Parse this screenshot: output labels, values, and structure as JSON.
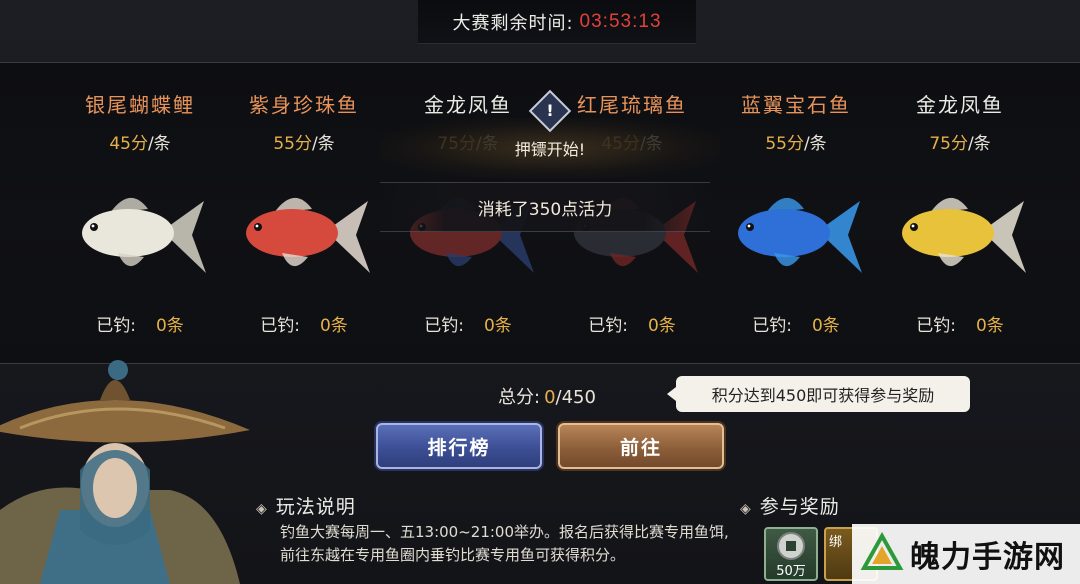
{
  "header": {
    "timer_label": "大赛剩余时间:",
    "timer_value": "03:53:13"
  },
  "fish": [
    {
      "name": "银尾蝴蝶鲤",
      "name_color": "#e8935a",
      "points": "45分",
      "unit": "/条",
      "caught_label": "已钓:",
      "caught": "0条",
      "body": "#e9e6dc",
      "fin": "#d6d2c6"
    },
    {
      "name": "紫身珍珠鱼",
      "name_color": "#e8935a",
      "points": "55分",
      "unit": "/条",
      "caught_label": "已钓:",
      "caught": "0条",
      "body": "#d64a3e",
      "fin": "#e8ddd2"
    },
    {
      "name": "金龙凤鱼",
      "name_color": "#ecebe6",
      "points": "75分",
      "unit": "/条",
      "caught_label": "已钓:",
      "caught": "0条",
      "body": "#c8423c",
      "fin": "#4a6fd0"
    },
    {
      "name": "红尾琉璃鱼",
      "name_color": "#e8935a",
      "points": "45分",
      "unit": "/条",
      "caught_label": "已钓:",
      "caught": "0条",
      "body": "#4a4f5c",
      "fin": "#e2413a"
    },
    {
      "name": "蓝翼宝石鱼",
      "name_color": "#e8935a",
      "points": "55分",
      "unit": "/条",
      "caught_label": "已钓:",
      "caught": "0条",
      "body": "#2f6fd8",
      "fin": "#3a9aee"
    },
    {
      "name": "金龙凤鱼",
      "name_color": "#ecebe6",
      "points": "75分",
      "unit": "/条",
      "caught_label": "已钓:",
      "caught": "0条",
      "body": "#e8c23a",
      "fin": "#e9e4d4"
    }
  ],
  "overlay": {
    "start_text": "押镖开始!",
    "cost_text": "消耗了350点活力",
    "warn_icon": "!"
  },
  "score": {
    "label": "总分:",
    "current": "0",
    "total": "/450"
  },
  "tooltip": "积分达到450即可获得参与奖励",
  "buttons": {
    "rank": "排行榜",
    "go": "前往"
  },
  "rules": {
    "title": "玩法说明",
    "text": "钓鱼大赛每周一、五13:00~21:00举办。报名后获得比赛专用鱼饵,前往东越在专用鱼圈内垂钓比赛专用鱼可获得积分。"
  },
  "rewards": {
    "title": "参与奖励",
    "coin_qty": "50万",
    "bound_tag": "绑"
  },
  "watermark": "魄力手游网"
}
